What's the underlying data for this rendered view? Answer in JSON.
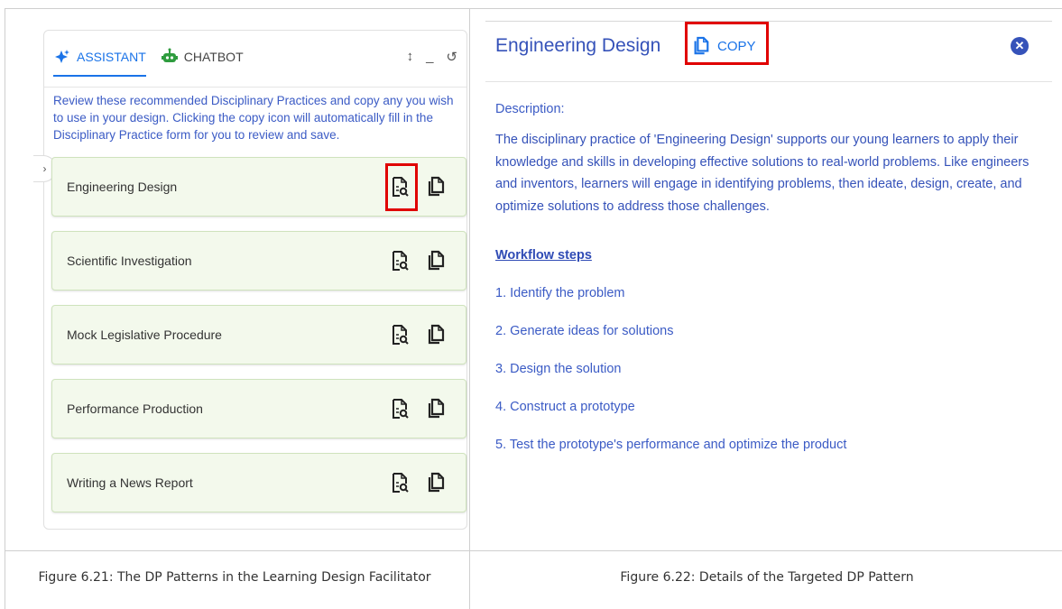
{
  "left_panel": {
    "tabs": [
      {
        "label": "ASSISTANT",
        "icon": "sparkle-icon",
        "active": true
      },
      {
        "label": "CHATBOT",
        "icon": "robot-icon",
        "active": false
      }
    ],
    "header_tools": {
      "resize": "↕",
      "minimize": "_",
      "history": "↺"
    },
    "intro_text": "Review these recommended Disciplinary Practices and copy any you wish to use in your design. Clicking the copy icon will automatically fill in the Disciplinary Practice form for you to review and save.",
    "collapse_glyph": "›",
    "practices": [
      {
        "label": "Engineering Design"
      },
      {
        "label": "Scientific Investigation"
      },
      {
        "label": "Mock Legislative Procedure"
      },
      {
        "label": "Performance Production"
      },
      {
        "label": "Writing a News Report"
      }
    ]
  },
  "right_panel": {
    "title": "Engineering Design",
    "copy_label": "COPY",
    "close_glyph": "✕",
    "description_label": "Description:",
    "description": "The disciplinary practice of 'Engineering Design' supports our young learners to apply their knowledge and skills in developing effective solutions to real-world problems. Like engineers and inventors, learners will engage in identifying problems, then ideate, design, create, and optimize solutions to address those challenges.",
    "workflow_heading": "Workflow steps",
    "steps": [
      "1. Identify the problem",
      "2. Generate ideas for solutions",
      "3. Design the solution",
      "4. Construct a prototype",
      "5. Test the prototype's performance and optimize the product"
    ]
  },
  "captions": {
    "left": "Figure 6.21: The DP Patterns in the Learning Design Facilitator",
    "right": "Figure 6.22: Details of the Targeted DP Pattern"
  },
  "colors": {
    "accent": "#1a73e8",
    "text_blue": "#3552b9",
    "card_bg": "#f3f9ec",
    "highlight": "#e00000",
    "robot_green": "#2e9c3e"
  }
}
